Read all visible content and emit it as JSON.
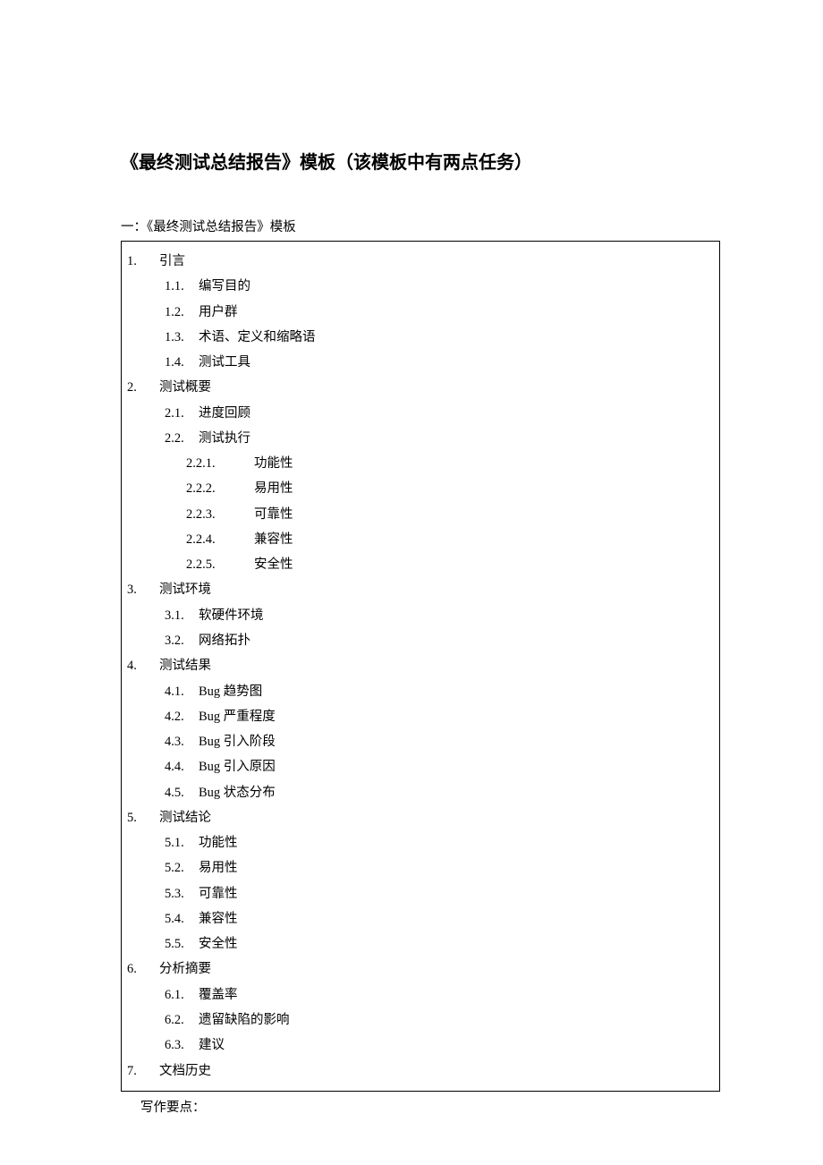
{
  "title": "《最终测试总结报告》模板（该模板中有两点任务）",
  "subtitle": "一：《最终测试总结报告》模板",
  "outline": {
    "s1": {
      "num": "1.",
      "text": "引言",
      "s1_1": {
        "num": "1.1.",
        "text": "编写目的"
      },
      "s1_2": {
        "num": "1.2.",
        "text": "用户群"
      },
      "s1_3": {
        "num": "1.3.",
        "text": "术语、定义和缩略语"
      },
      "s1_4": {
        "num": "1.4.",
        "text": "测试工具"
      }
    },
    "s2": {
      "num": "2.",
      "text": "测试概要",
      "s2_1": {
        "num": "2.1.",
        "text": "进度回顾"
      },
      "s2_2": {
        "num": "2.2.",
        "text": "测试执行",
        "s2_2_1": {
          "num": "2.2.1.",
          "text": "功能性"
        },
        "s2_2_2": {
          "num": "2.2.2.",
          "text": "易用性"
        },
        "s2_2_3": {
          "num": "2.2.3.",
          "text": "可靠性"
        },
        "s2_2_4": {
          "num": "2.2.4.",
          "text": "兼容性"
        },
        "s2_2_5": {
          "num": "2.2.5.",
          "text": "安全性"
        }
      }
    },
    "s3": {
      "num": "3.",
      "text": "测试环境",
      "s3_1": {
        "num": "3.1.",
        "text": "软硬件环境"
      },
      "s3_2": {
        "num": "3.2.",
        "text": "网络拓扑"
      }
    },
    "s4": {
      "num": "4.",
      "text": "测试结果",
      "s4_1": {
        "num": "4.1.",
        "text": "Bug 趋势图"
      },
      "s4_2": {
        "num": "4.2.",
        "text": "Bug 严重程度"
      },
      "s4_3": {
        "num": "4.3.",
        "text": "Bug 引入阶段"
      },
      "s4_4": {
        "num": "4.4.",
        "text": "Bug 引入原因"
      },
      "s4_5": {
        "num": "4.5.",
        "text": "Bug 状态分布"
      }
    },
    "s5": {
      "num": "5.",
      "text": "测试结论",
      "s5_1": {
        "num": "5.1.",
        "text": "功能性"
      },
      "s5_2": {
        "num": "5.2.",
        "text": "易用性"
      },
      "s5_3": {
        "num": "5.3.",
        "text": "可靠性"
      },
      "s5_4": {
        "num": "5.4.",
        "text": "兼容性"
      },
      "s5_5": {
        "num": "5.5.",
        "text": "安全性"
      }
    },
    "s6": {
      "num": "6.",
      "text": "分析摘要",
      "s6_1": {
        "num": "6.1.",
        "text": "覆盖率"
      },
      "s6_2": {
        "num": "6.2.",
        "text": "遗留缺陷的影响"
      },
      "s6_3": {
        "num": "6.3.",
        "text": "建议"
      }
    },
    "s7": {
      "num": "7.",
      "text": "文档历史"
    }
  },
  "footer_note": "写作要点："
}
